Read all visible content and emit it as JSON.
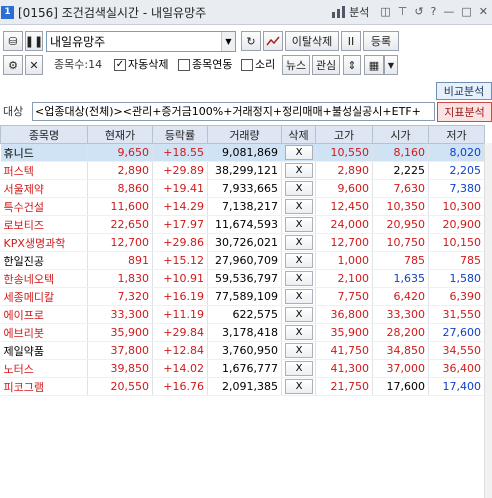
{
  "window": {
    "screen_no": "[0156]",
    "title": "조건검색실시간 - 내일유망주",
    "analysis_label": "분석",
    "help_label": "?"
  },
  "toolbar": {
    "condition_name": "내일유망주",
    "delete_button": "이탈삭제",
    "pause_button": "II",
    "register_button": "등록",
    "count_label": "종목수:14",
    "auto_delete_label": "자동삭제",
    "auto_delete_checked": true,
    "link_label": "종목연동",
    "link_checked": false,
    "sound_label": "소리",
    "sound_checked": false,
    "news_button": "뉴스",
    "interest_button": "관심"
  },
  "tabs": {
    "compare": "비교분석",
    "indicator": "지표분석"
  },
  "target": {
    "label": "대상",
    "value": "<업종대상(전체)><관리+증거금100%+거래정지+정리매매+불성실공시+ETF+"
  },
  "table": {
    "headers": [
      "종목명",
      "현재가",
      "등락률",
      "거래량",
      "삭제",
      "고가",
      "시가",
      "저가"
    ],
    "rows": [
      {
        "name": "휴니드",
        "price": "9,650",
        "rate": "+18.55",
        "volume": "9,081,869",
        "del": "X",
        "high": "10,550",
        "open": "8,160",
        "low": "8,020",
        "name_color": "flat",
        "open_color": "up",
        "low_color": "dn",
        "selected": true
      },
      {
        "name": "퍼스텍",
        "price": "2,890",
        "rate": "+29.89",
        "volume": "38,299,121",
        "del": "X",
        "high": "2,890",
        "open": "2,225",
        "low": "2,205",
        "name_color": "up",
        "open_color": "flat",
        "low_color": "dn",
        "selected": false
      },
      {
        "name": "서울제약",
        "price": "8,860",
        "rate": "+19.41",
        "volume": "7,933,665",
        "del": "X",
        "high": "9,600",
        "open": "7,630",
        "low": "7,380",
        "name_color": "up",
        "open_color": "up",
        "low_color": "dn",
        "selected": false
      },
      {
        "name": "특수건설",
        "price": "11,600",
        "rate": "+14.29",
        "volume": "7,138,217",
        "del": "X",
        "high": "12,450",
        "open": "10,350",
        "low": "10,300",
        "name_color": "up",
        "open_color": "up",
        "low_color": "up",
        "selected": false
      },
      {
        "name": "로보티즈",
        "price": "22,650",
        "rate": "+17.97",
        "volume": "11,674,593",
        "del": "X",
        "high": "24,000",
        "open": "20,950",
        "low": "20,900",
        "name_color": "up",
        "open_color": "up",
        "low_color": "up",
        "selected": false
      },
      {
        "name": "KPX생명과학",
        "price": "12,700",
        "rate": "+29.86",
        "volume": "30,726,021",
        "del": "X",
        "high": "12,700",
        "open": "10,750",
        "low": "10,150",
        "name_color": "up",
        "open_color": "up",
        "low_color": "up",
        "selected": false
      },
      {
        "name": "한일진공",
        "price": "891",
        "rate": "+15.12",
        "volume": "27,960,709",
        "del": "X",
        "high": "1,000",
        "open": "785",
        "low": "785",
        "name_color": "flat",
        "open_color": "up",
        "low_color": "up",
        "selected": false
      },
      {
        "name": "한송네오텍",
        "price": "1,830",
        "rate": "+10.91",
        "volume": "59,536,797",
        "del": "X",
        "high": "2,100",
        "open": "1,635",
        "low": "1,580",
        "name_color": "up",
        "open_color": "dn",
        "low_color": "dn",
        "selected": false
      },
      {
        "name": "세종메디칼",
        "price": "7,320",
        "rate": "+16.19",
        "volume": "77,589,109",
        "del": "X",
        "high": "7,750",
        "open": "6,420",
        "low": "6,390",
        "name_color": "up",
        "open_color": "up",
        "low_color": "up",
        "selected": false
      },
      {
        "name": "에이프로",
        "price": "33,300",
        "rate": "+11.19",
        "volume": "622,575",
        "del": "X",
        "high": "36,800",
        "open": "33,300",
        "low": "31,550",
        "name_color": "up",
        "open_color": "up",
        "low_color": "up",
        "selected": false
      },
      {
        "name": "에브리봇",
        "price": "35,900",
        "rate": "+29.84",
        "volume": "3,178,418",
        "del": "X",
        "high": "35,900",
        "open": "28,200",
        "low": "27,600",
        "name_color": "up",
        "open_color": "up",
        "low_color": "dn",
        "selected": false
      },
      {
        "name": "제일약품",
        "price": "37,800",
        "rate": "+12.84",
        "volume": "3,760,950",
        "del": "X",
        "high": "41,750",
        "open": "34,850",
        "low": "34,550",
        "name_color": "flat",
        "open_color": "up",
        "low_color": "up",
        "selected": false
      },
      {
        "name": "노터스",
        "price": "39,850",
        "rate": "+14.02",
        "volume": "1,676,777",
        "del": "X",
        "high": "41,300",
        "open": "37,000",
        "low": "36,400",
        "name_color": "up",
        "open_color": "up",
        "low_color": "up",
        "selected": false
      },
      {
        "name": "피코그램",
        "price": "20,550",
        "rate": "+16.76",
        "volume": "2,091,385",
        "del": "X",
        "high": "21,750",
        "open": "17,600",
        "low": "17,400",
        "name_color": "up",
        "open_color": "flat",
        "low_color": "dn",
        "selected": false
      }
    ]
  },
  "colors": {
    "up": "#d11a1a",
    "down": "#1040c8",
    "header_bg": "#dde6f2",
    "selected_row": "#cfe3f5"
  }
}
